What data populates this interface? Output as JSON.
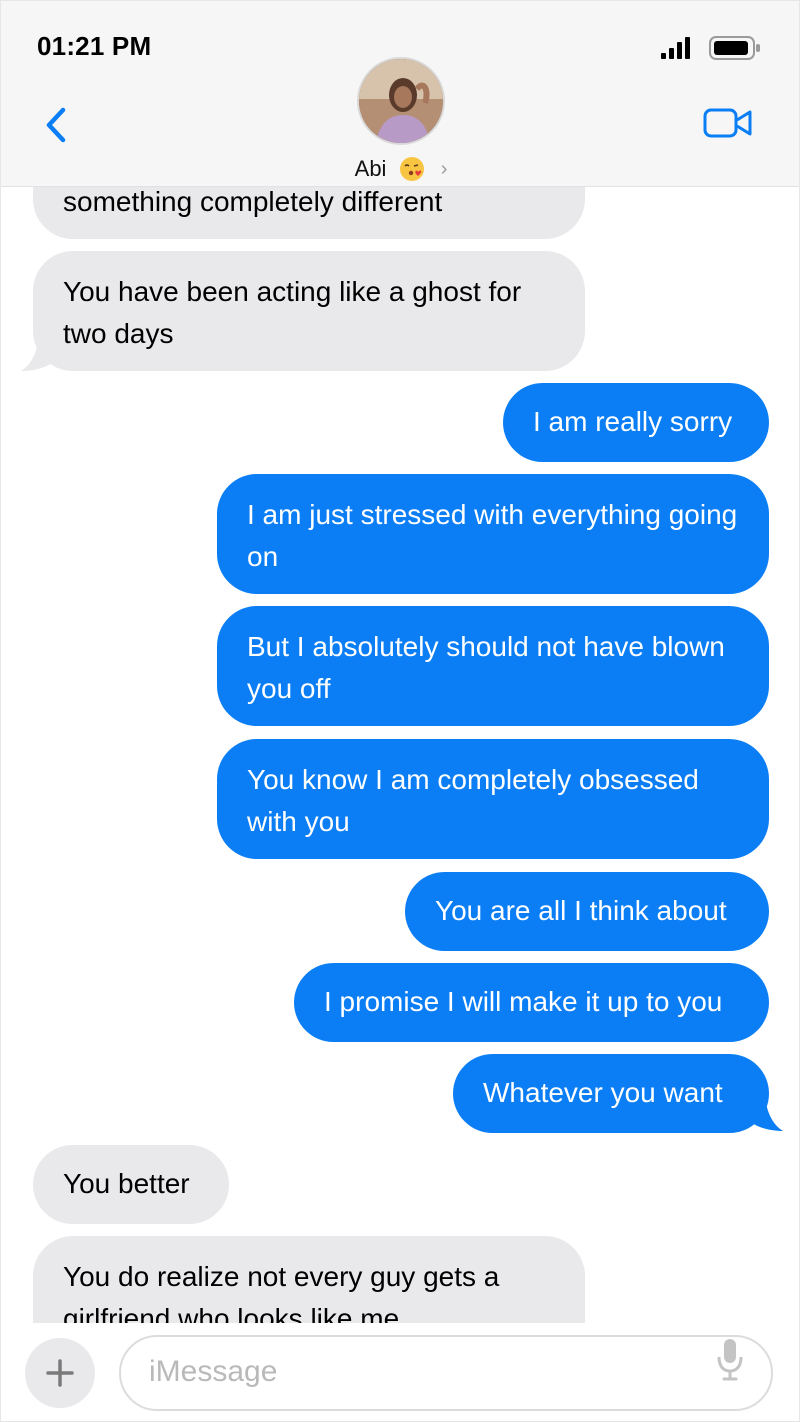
{
  "status_bar": {
    "time": "01:21 PM"
  },
  "header": {
    "contact_name": "Abi"
  },
  "messages": [
    {
      "from": "them",
      "text": "something completely different"
    },
    {
      "from": "them",
      "text": "You have been acting like a ghost for two days"
    },
    {
      "from": "me",
      "text": "I am really sorry"
    },
    {
      "from": "me",
      "text": "I am just stressed with everything going on"
    },
    {
      "from": "me",
      "text": "But I absolutely should not have blown you off"
    },
    {
      "from": "me",
      "text": "You know I am completely obsessed with you"
    },
    {
      "from": "me",
      "text": "You are all I think about"
    },
    {
      "from": "me",
      "text": "I promise I will make it up to you"
    },
    {
      "from": "me",
      "text": "Whatever you want"
    },
    {
      "from": "them",
      "text": "You better"
    },
    {
      "from": "them",
      "text": "You do realize not every guy gets a girlfriend who looks like me"
    }
  ],
  "composer": {
    "placeholder": "iMessage"
  },
  "icons": {
    "back": "chevron-left-icon",
    "video": "video-camera-icon",
    "plus": "plus-icon",
    "mic": "microphone-icon",
    "emoji": "kissing-face-emoji"
  },
  "colors": {
    "accent": "#0b7ef5",
    "incoming_bubble": "#e9e9eb",
    "header_bg": "#f6f6f6"
  }
}
